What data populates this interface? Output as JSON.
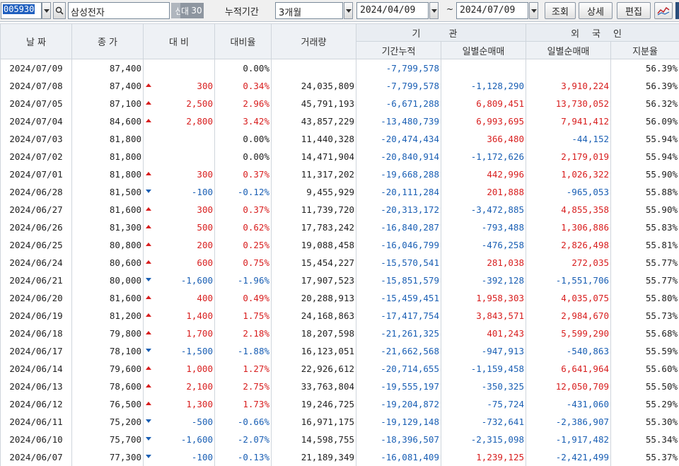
{
  "toolbar": {
    "stock_code": "005930",
    "stock_name": "삼성전자",
    "badge_a": "신",
    "badge_b": "대",
    "badge_c": "30",
    "period_label": "누적기간",
    "period_value": "3개월",
    "start_date": "2024/04/09",
    "tilde": "~",
    "end_date": "2024/07/09",
    "query_button": "조회",
    "detail_button": "상세",
    "edit_button": "편집"
  },
  "header": {
    "date": "날 짜",
    "close": "종 가",
    "change": "대 비",
    "change_rate": "대비율",
    "volume": "거래량",
    "institution": "기 관",
    "inst_cum": "기간누적",
    "inst_daily": "일별순매매",
    "foreign": "외국인",
    "for_daily": "일별순매매",
    "for_share": "지분율"
  },
  "rows": [
    {
      "date": "2024/07/09",
      "close": "87,400",
      "dir": "none",
      "change": "",
      "rate": "0.00%",
      "volume": "",
      "inst_cum": "-7,799,578",
      "inst_daily": "",
      "for_daily": "",
      "share": "56.39%"
    },
    {
      "date": "2024/07/08",
      "close": "87,400",
      "dir": "up",
      "change": "300",
      "rate": "0.34%",
      "volume": "24,035,809",
      "inst_cum": "-7,799,578",
      "inst_daily": "-1,128,290",
      "for_daily": "3,910,224",
      "share": "56.39%"
    },
    {
      "date": "2024/07/05",
      "close": "87,100",
      "dir": "up",
      "change": "2,500",
      "rate": "2.96%",
      "volume": "45,791,193",
      "inst_cum": "-6,671,288",
      "inst_daily": "6,809,451",
      "for_daily": "13,730,052",
      "share": "56.32%"
    },
    {
      "date": "2024/07/04",
      "close": "84,600",
      "dir": "up",
      "change": "2,800",
      "rate": "3.42%",
      "volume": "43,857,229",
      "inst_cum": "-13,480,739",
      "inst_daily": "6,993,695",
      "for_daily": "7,941,412",
      "share": "56.09%"
    },
    {
      "date": "2024/07/03",
      "close": "81,800",
      "dir": "none",
      "change": "",
      "rate": "0.00%",
      "volume": "11,440,328",
      "inst_cum": "-20,474,434",
      "inst_daily": "366,480",
      "for_daily": "-44,152",
      "share": "55.94%"
    },
    {
      "date": "2024/07/02",
      "close": "81,800",
      "dir": "none",
      "change": "",
      "rate": "0.00%",
      "volume": "14,471,904",
      "inst_cum": "-20,840,914",
      "inst_daily": "-1,172,626",
      "for_daily": "2,179,019",
      "share": "55.94%"
    },
    {
      "date": "2024/07/01",
      "close": "81,800",
      "dir": "up",
      "change": "300",
      "rate": "0.37%",
      "volume": "11,317,202",
      "inst_cum": "-19,668,288",
      "inst_daily": "442,996",
      "for_daily": "1,026,322",
      "share": "55.90%"
    },
    {
      "date": "2024/06/28",
      "close": "81,500",
      "dir": "down",
      "change": "-100",
      "rate": "-0.12%",
      "volume": "9,455,929",
      "inst_cum": "-20,111,284",
      "inst_daily": "201,888",
      "for_daily": "-965,053",
      "share": "55.88%"
    },
    {
      "date": "2024/06/27",
      "close": "81,600",
      "dir": "up",
      "change": "300",
      "rate": "0.37%",
      "volume": "11,739,720",
      "inst_cum": "-20,313,172",
      "inst_daily": "-3,472,885",
      "for_daily": "4,855,358",
      "share": "55.90%"
    },
    {
      "date": "2024/06/26",
      "close": "81,300",
      "dir": "up",
      "change": "500",
      "rate": "0.62%",
      "volume": "17,783,242",
      "inst_cum": "-16,840,287",
      "inst_daily": "-793,488",
      "for_daily": "1,306,886",
      "share": "55.83%"
    },
    {
      "date": "2024/06/25",
      "close": "80,800",
      "dir": "up",
      "change": "200",
      "rate": "0.25%",
      "volume": "19,088,458",
      "inst_cum": "-16,046,799",
      "inst_daily": "-476,258",
      "for_daily": "2,826,498",
      "share": "55.81%"
    },
    {
      "date": "2024/06/24",
      "close": "80,600",
      "dir": "up",
      "change": "600",
      "rate": "0.75%",
      "volume": "15,454,227",
      "inst_cum": "-15,570,541",
      "inst_daily": "281,038",
      "for_daily": "272,035",
      "share": "55.77%"
    },
    {
      "date": "2024/06/21",
      "close": "80,000",
      "dir": "down",
      "change": "-1,600",
      "rate": "-1.96%",
      "volume": "17,907,523",
      "inst_cum": "-15,851,579",
      "inst_daily": "-392,128",
      "for_daily": "-1,551,706",
      "share": "55.77%"
    },
    {
      "date": "2024/06/20",
      "close": "81,600",
      "dir": "up",
      "change": "400",
      "rate": "0.49%",
      "volume": "20,288,913",
      "inst_cum": "-15,459,451",
      "inst_daily": "1,958,303",
      "for_daily": "4,035,075",
      "share": "55.80%"
    },
    {
      "date": "2024/06/19",
      "close": "81,200",
      "dir": "up",
      "change": "1,400",
      "rate": "1.75%",
      "volume": "24,168,863",
      "inst_cum": "-17,417,754",
      "inst_daily": "3,843,571",
      "for_daily": "2,984,670",
      "share": "55.73%"
    },
    {
      "date": "2024/06/18",
      "close": "79,800",
      "dir": "up",
      "change": "1,700",
      "rate": "2.18%",
      "volume": "18,207,598",
      "inst_cum": "-21,261,325",
      "inst_daily": "401,243",
      "for_daily": "5,599,290",
      "share": "55.68%"
    },
    {
      "date": "2024/06/17",
      "close": "78,100",
      "dir": "down",
      "change": "-1,500",
      "rate": "-1.88%",
      "volume": "16,123,051",
      "inst_cum": "-21,662,568",
      "inst_daily": "-947,913",
      "for_daily": "-540,863",
      "share": "55.59%"
    },
    {
      "date": "2024/06/14",
      "close": "79,600",
      "dir": "up",
      "change": "1,000",
      "rate": "1.27%",
      "volume": "22,926,612",
      "inst_cum": "-20,714,655",
      "inst_daily": "-1,159,458",
      "for_daily": "6,641,964",
      "share": "55.60%"
    },
    {
      "date": "2024/06/13",
      "close": "78,600",
      "dir": "up",
      "change": "2,100",
      "rate": "2.75%",
      "volume": "33,763,804",
      "inst_cum": "-19,555,197",
      "inst_daily": "-350,325",
      "for_daily": "12,050,709",
      "share": "55.50%"
    },
    {
      "date": "2024/06/12",
      "close": "76,500",
      "dir": "up",
      "change": "1,300",
      "rate": "1.73%",
      "volume": "19,246,725",
      "inst_cum": "-19,204,872",
      "inst_daily": "-75,724",
      "for_daily": "-431,060",
      "share": "55.29%"
    },
    {
      "date": "2024/06/11",
      "close": "75,200",
      "dir": "down",
      "change": "-500",
      "rate": "-0.66%",
      "volume": "16,971,175",
      "inst_cum": "-19,129,148",
      "inst_daily": "-732,641",
      "for_daily": "-2,386,907",
      "share": "55.30%"
    },
    {
      "date": "2024/06/10",
      "close": "75,700",
      "dir": "down",
      "change": "-1,600",
      "rate": "-2.07%",
      "volume": "14,598,755",
      "inst_cum": "-18,396,507",
      "inst_daily": "-2,315,098",
      "for_daily": "-1,917,482",
      "share": "55.34%"
    },
    {
      "date": "2024/06/07",
      "close": "77,300",
      "dir": "down",
      "change": "-100",
      "rate": "-0.13%",
      "volume": "21,189,349",
      "inst_cum": "-16,081,409",
      "inst_daily": "1,239,125",
      "for_daily": "-2,421,499",
      "share": "55.37%"
    }
  ]
}
